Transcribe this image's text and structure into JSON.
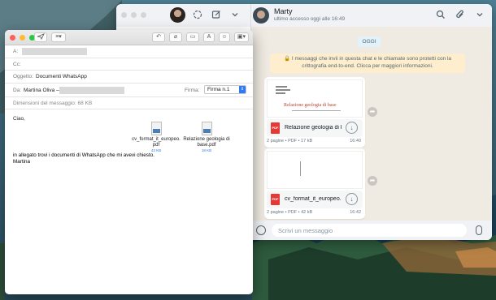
{
  "whatsapp": {
    "contact_name": "Marty",
    "contact_status": "ultimo accesso oggi alle 16:49",
    "day_chip": "OGGI",
    "encryption_note": "🔒 I messaggi che invii in questa chat e le chiamate sono protetti con la crittografia end-to-end. Clicca per maggiori informazioni.",
    "messages": [
      {
        "thumb_title": "Relazione geologia di base",
        "file_name": "Relazione geologia di b...",
        "meta": "2 pagine • PDF • 17 kB",
        "time": "16:40"
      },
      {
        "file_name": "cv_format_it_europeo....",
        "meta": "2 pagine • PDF • 42 kB",
        "time": "16:42"
      }
    ],
    "input_placeholder": "Scrivi un messaggio",
    "icons": [
      "status-icon",
      "new-chat-icon",
      "menu-chevron-icon",
      "search-icon",
      "attach-icon",
      "menu-chevron-icon",
      "emoji-icon",
      "mic-icon",
      "download-icon",
      "forward-icon"
    ]
  },
  "mail": {
    "to_label": "A:",
    "cc_label": "Cc:",
    "subject_label": "Oggetto:",
    "subject_value": "Documenti WhatsApp",
    "from_label": "Da:",
    "from_name": "Martina Oliva –",
    "signature_label": "Firma:",
    "signature_value": "Firma n.1",
    "size_info": "Dimensioni del messaggio: 68 KB",
    "greeting": "Ciao,",
    "attachments": [
      {
        "name": "cv_format_it_europeo.pdf",
        "name_line1": "cv_format_it_europeo.",
        "name_line2": "pdf",
        "size": "43 KB"
      },
      {
        "name": "Relazione geologia di base.pdf",
        "name_line1": "Relazione geologia di",
        "name_line2": "base.pdf",
        "size": "18 KB"
      }
    ],
    "body_line1": "in allegato trovi i documenti di WhatsApp che mi avevi chiesto.",
    "body_line2": "Martina",
    "toolbar_icons": [
      "send-icon",
      "list-icon",
      "reply-icon",
      "paperclip-icon",
      "attachment-icon",
      "font-icon",
      "emoji-icon",
      "photo-icon"
    ]
  }
}
